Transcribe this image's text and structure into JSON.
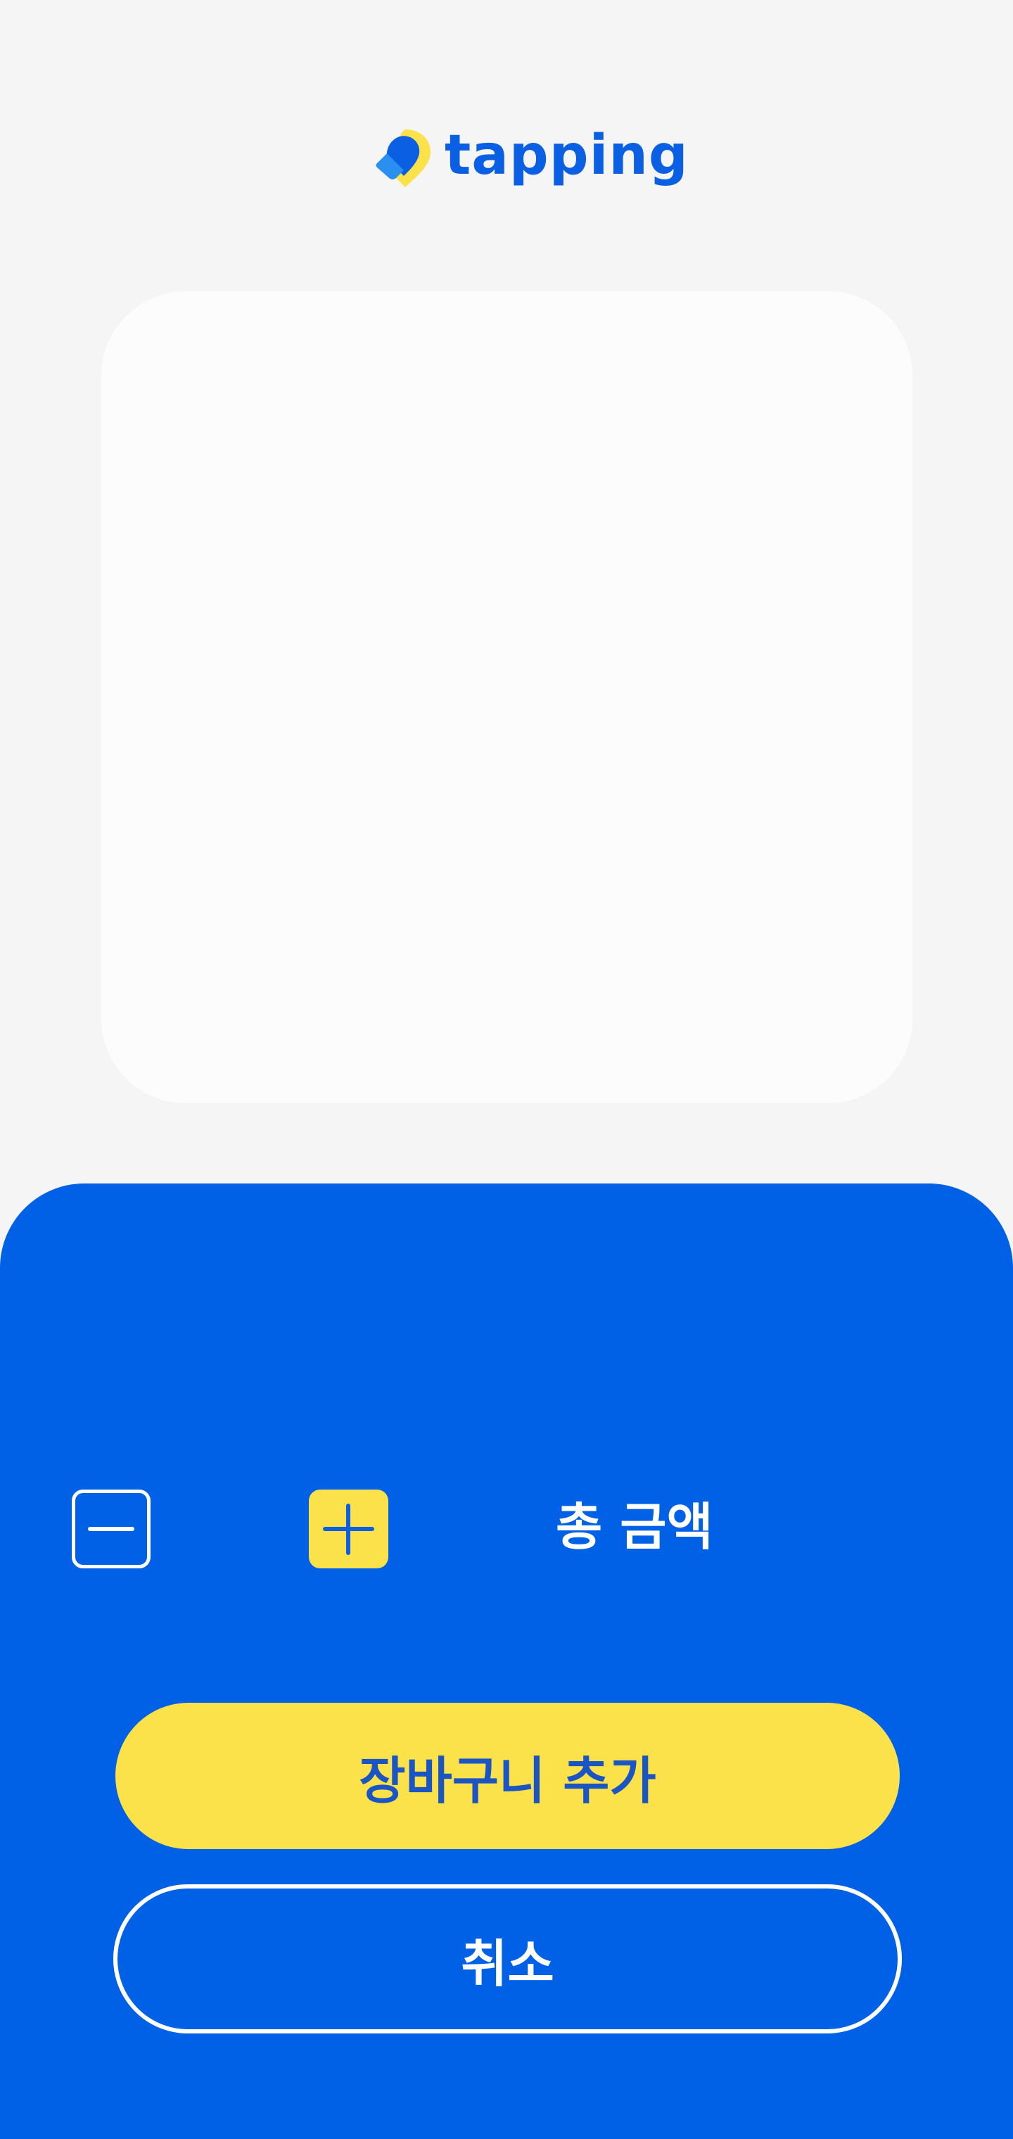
{
  "header": {
    "logo_icon": "tapping-logo-icon",
    "logo_text": "tapping"
  },
  "quantity": {
    "decrease_icon": "minus-icon",
    "increase_icon": "plus-icon"
  },
  "summary": {
    "total_label": "총 금액"
  },
  "actions": {
    "add_to_cart_label": "장바구니 추가",
    "cancel_label": "취소"
  },
  "colors": {
    "brand_blue": "#0060e6",
    "accent_yellow": "#fbe24a",
    "background": "#f5f5f5",
    "card": "#fcfcfc",
    "white": "#ffffff"
  }
}
